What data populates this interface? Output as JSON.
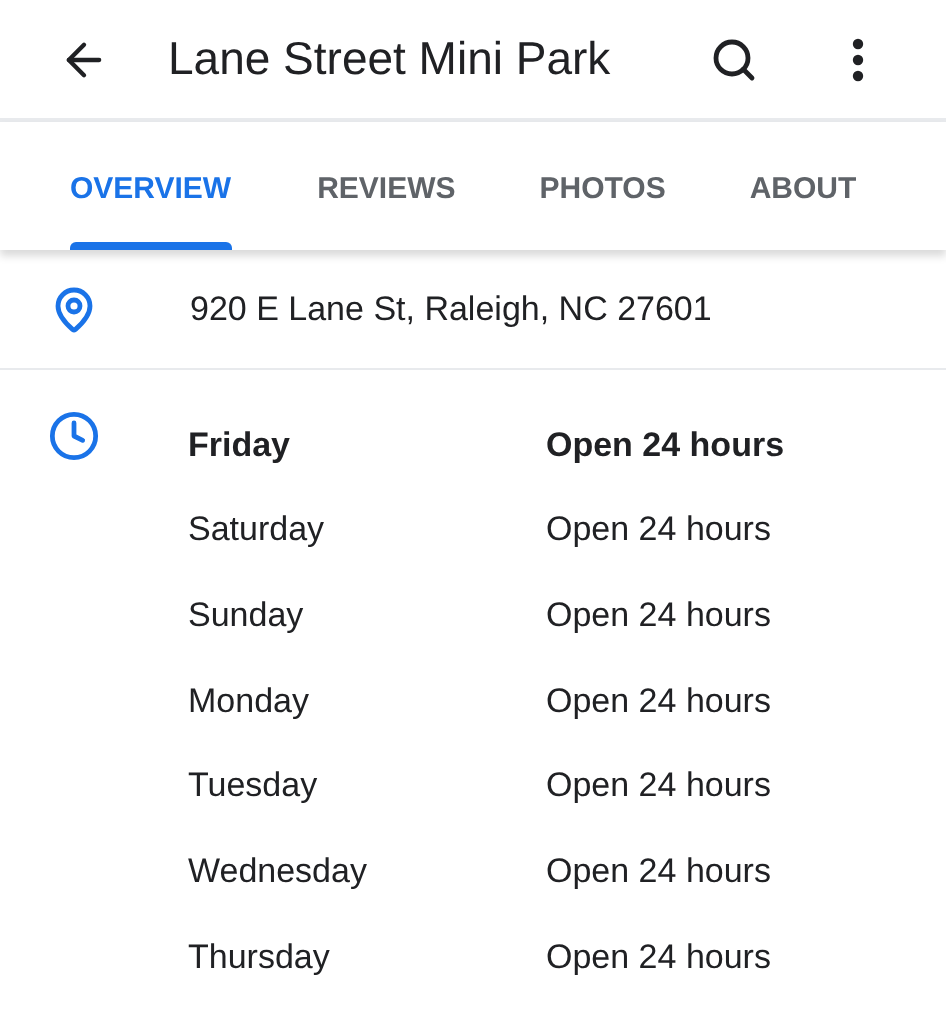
{
  "app_bar": {
    "title": "Lane Street Mini Park"
  },
  "tabs": [
    {
      "label": "OVERVIEW",
      "selected": true
    },
    {
      "label": "REVIEWS",
      "selected": false
    },
    {
      "label": "PHOTOS",
      "selected": false
    },
    {
      "label": "ABOUT",
      "selected": false
    }
  ],
  "address": "920 E Lane St, Raleigh, NC 27601",
  "hours": [
    {
      "day": "Friday",
      "time": "Open 24 hours",
      "today": true
    },
    {
      "day": "Saturday",
      "time": "Open 24 hours",
      "today": false
    },
    {
      "day": "Sunday",
      "time": "Open 24 hours",
      "today": false
    },
    {
      "day": "Monday",
      "time": "Open 24 hours",
      "today": false
    },
    {
      "day": "Tuesday",
      "time": "Open 24 hours",
      "today": false
    },
    {
      "day": "Wednesday",
      "time": "Open 24 hours",
      "today": false
    },
    {
      "day": "Thursday",
      "time": "Open 24 hours",
      "today": false
    }
  ]
}
